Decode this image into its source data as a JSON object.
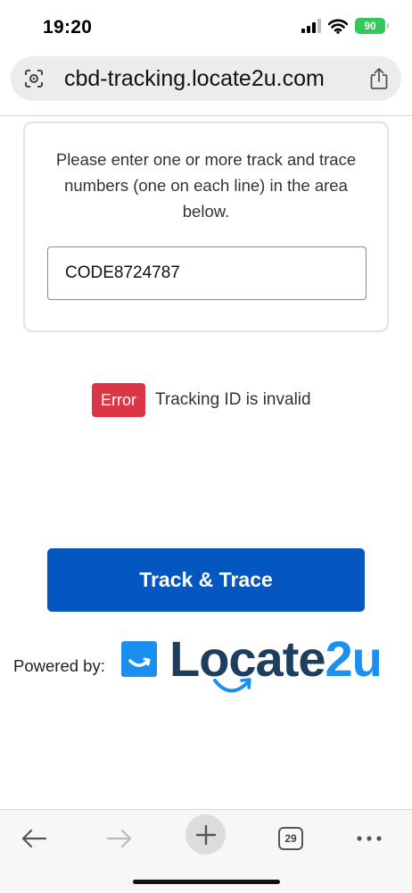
{
  "status_bar": {
    "time": "19:20",
    "battery": "90",
    "icons": [
      "signal-icon",
      "wifi-icon",
      "battery-icon"
    ]
  },
  "address_bar": {
    "url": "cbd-tracking.locate2u.com",
    "left_icon": "google-lens-icon",
    "right_icon": "share-icon"
  },
  "card": {
    "instructions": "Please enter one or more track and trace numbers (one on each line) in the area below.",
    "input_value": "CODE8724787"
  },
  "error": {
    "badge": "Error",
    "message": "Tracking ID is invalid",
    "color": "#dc3545"
  },
  "track_button": {
    "label": "Track & Trace",
    "color": "#0456c1"
  },
  "footer": {
    "powered_by": "Powered by:",
    "logo_part1": "Locate",
    "logo_part2": "2u",
    "logo_dark_color": "#1f3e5e",
    "logo_light_color": "#1b8ff0"
  },
  "toolbar": {
    "tab_count": "29",
    "icons": [
      "back-arrow-icon",
      "forward-arrow-icon",
      "plus-icon",
      "tabs-icon",
      "more-icon"
    ]
  }
}
